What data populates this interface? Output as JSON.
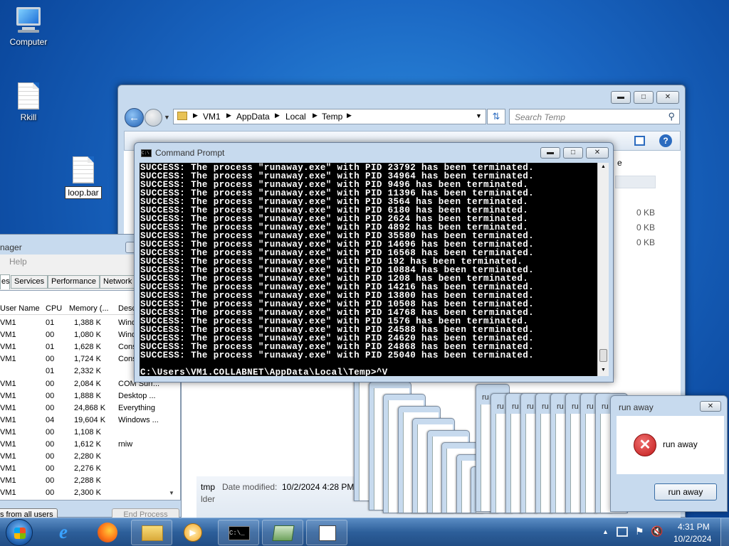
{
  "desktop": {
    "icons": [
      {
        "label": "Computer"
      },
      {
        "label": "Rkill"
      },
      {
        "label": "loop.bar"
      }
    ]
  },
  "explorer": {
    "breadcrumb": [
      "VM1",
      "AppData",
      "Local",
      "Temp"
    ],
    "search_placeholder": "Search Temp",
    "file_sizes": [
      "0 KB",
      "0 KB",
      "0 KB"
    ],
    "details_name": "tmp",
    "details_modified_label": "Date modified:",
    "details_modified_value": "10/2/2024 4:28 PM",
    "details_type": "lder",
    "partial_letter": "e"
  },
  "cmd": {
    "title": "Command Prompt",
    "lines": [
      "SUCCESS: The process \"runaway.exe\" with PID 23792 has been terminated.",
      "SUCCESS: The process \"runaway.exe\" with PID 34964 has been terminated.",
      "SUCCESS: The process \"runaway.exe\" with PID 9496 has been terminated.",
      "SUCCESS: The process \"runaway.exe\" with PID 11396 has been terminated.",
      "SUCCESS: The process \"runaway.exe\" with PID 3564 has been terminated.",
      "SUCCESS: The process \"runaway.exe\" with PID 6180 has been terminated.",
      "SUCCESS: The process \"runaway.exe\" with PID 2624 has been terminated.",
      "SUCCESS: The process \"runaway.exe\" with PID 4892 has been terminated.",
      "SUCCESS: The process \"runaway.exe\" with PID 35580 has been terminated.",
      "SUCCESS: The process \"runaway.exe\" with PID 14696 has been terminated.",
      "SUCCESS: The process \"runaway.exe\" with PID 16568 has been terminated.",
      "SUCCESS: The process \"runaway.exe\" with PID 192 has been terminated.",
      "SUCCESS: The process \"runaway.exe\" with PID 10884 has been terminated.",
      "SUCCESS: The process \"runaway.exe\" with PID 1208 has been terminated.",
      "SUCCESS: The process \"runaway.exe\" with PID 14216 has been terminated.",
      "SUCCESS: The process \"runaway.exe\" with PID 13800 has been terminated.",
      "SUCCESS: The process \"runaway.exe\" with PID 10508 has been terminated.",
      "SUCCESS: The process \"runaway.exe\" with PID 14768 has been terminated.",
      "SUCCESS: The process \"runaway.exe\" with PID 1576 has been terminated.",
      "SUCCESS: The process \"runaway.exe\" with PID 24588 has been terminated.",
      "SUCCESS: The process \"runaway.exe\" with PID 24620 has been terminated.",
      "SUCCESS: The process \"runaway.exe\" with PID 24868 has been terminated.",
      "SUCCESS: The process \"runaway.exe\" with PID 25040 has been terminated."
    ],
    "prompt": "C:\\Users\\VM1.COLLABNET\\AppData\\Local\\Temp>^V"
  },
  "taskmgr": {
    "title": "nager",
    "menu_help": "Help",
    "tabs": [
      "es",
      "Services",
      "Performance",
      "Network"
    ],
    "columns": [
      "User Name",
      "CPU",
      "Memory (...",
      "Desc"
    ],
    "rows": [
      {
        "user": "VM1",
        "cpu": "01",
        "mem": "1,388 K",
        "desc": "Wind"
      },
      {
        "user": "VM1",
        "cpu": "00",
        "mem": "1,080 K",
        "desc": "Wind"
      },
      {
        "user": "VM1",
        "cpu": "01",
        "mem": "1,628 K",
        "desc": "Cons"
      },
      {
        "user": "VM1",
        "cpu": "00",
        "mem": "1,724 K",
        "desc": "Cons"
      },
      {
        "user": "",
        "cpu": "01",
        "mem": "2,332 K",
        "desc": ""
      },
      {
        "user": "VM1",
        "cpu": "00",
        "mem": "2,084 K",
        "desc": "COM Surr..."
      },
      {
        "user": "VM1",
        "cpu": "00",
        "mem": "1,888 K",
        "desc": "Desktop ..."
      },
      {
        "user": "VM1",
        "cpu": "00",
        "mem": "24,868 K",
        "desc": "Everything"
      },
      {
        "user": "VM1",
        "cpu": "04",
        "mem": "19,604 K",
        "desc": "Windows ..."
      },
      {
        "user": "VM1",
        "cpu": "00",
        "mem": "1,108 K",
        "desc": ""
      },
      {
        "user": "VM1",
        "cpu": "00",
        "mem": "1,612 K",
        "desc": "rniw"
      },
      {
        "user": "VM1",
        "cpu": "00",
        "mem": "2,280 K",
        "desc": ""
      },
      {
        "user": "VM1",
        "cpu": "00",
        "mem": "2,276 K",
        "desc": ""
      },
      {
        "user": "VM1",
        "cpu": "00",
        "mem": "2,288 K",
        "desc": ""
      },
      {
        "user": "VM1",
        "cpu": "00",
        "mem": "2,300 K",
        "desc": ""
      }
    ],
    "show_all_label": "s from all users",
    "end_process_label": "End Process"
  },
  "popup": {
    "title": "run away",
    "message": "run away",
    "button": "run away",
    "stack_label": "ru"
  },
  "tray": {
    "time": "4:31 PM",
    "date": "10/2/2024"
  },
  "colors": {
    "cmd_bg": "#000000",
    "error_red": "#d42b2b",
    "desktop_blue": "#1a66c2"
  }
}
